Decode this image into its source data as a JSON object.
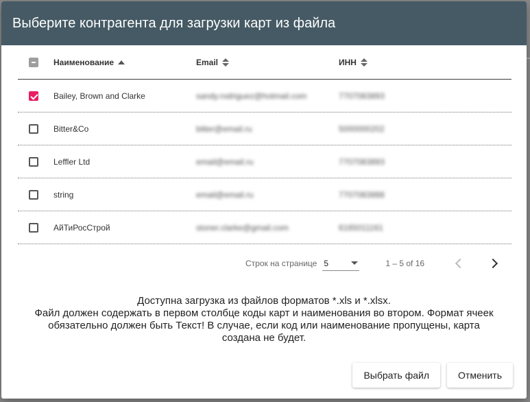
{
  "dialog": {
    "title": "Выберите контрагента для загрузки карт из файла"
  },
  "table": {
    "columns": {
      "name": "Наименование",
      "email": "Email",
      "inn": "ИНН"
    },
    "rows": [
      {
        "checked": true,
        "name": "Bailey, Brown and Clarke",
        "email": "sandy.rodriguez@hotmail.com",
        "inn": "7707083893"
      },
      {
        "checked": false,
        "name": "Bitter&Co",
        "email": "bitter@email.ru",
        "inn": "5000000202"
      },
      {
        "checked": false,
        "name": "Leffler Ltd",
        "email": "email@email.ru",
        "inn": "7707083893"
      },
      {
        "checked": false,
        "name": "string",
        "email": "email@email.ru",
        "inn": "7707083888"
      },
      {
        "checked": false,
        "name": "АйТиРосСтрой",
        "email": "stoner.clarke@gmail.com",
        "inn": "6165011161"
      }
    ]
  },
  "paginator": {
    "rows_per_page_label": "Строк на странице",
    "rows_per_page_value": "5",
    "range": "1 – 5 of 16"
  },
  "info": {
    "line1": "Доступна загрузка из файлов форматов *.xls и *.xlsx.",
    "line2": "Файл должен содержать в первом столбце коды карт и наименования во втором. Формат ячеек обязательно должен быть Текст! В случае, если код или наименование пропущены, карта создана не будет."
  },
  "actions": {
    "choose_file": "Выбрать файл",
    "cancel": "Отменить"
  },
  "colors": {
    "header_bg": "#455a64",
    "checkbox_accent": "#e91e63"
  }
}
